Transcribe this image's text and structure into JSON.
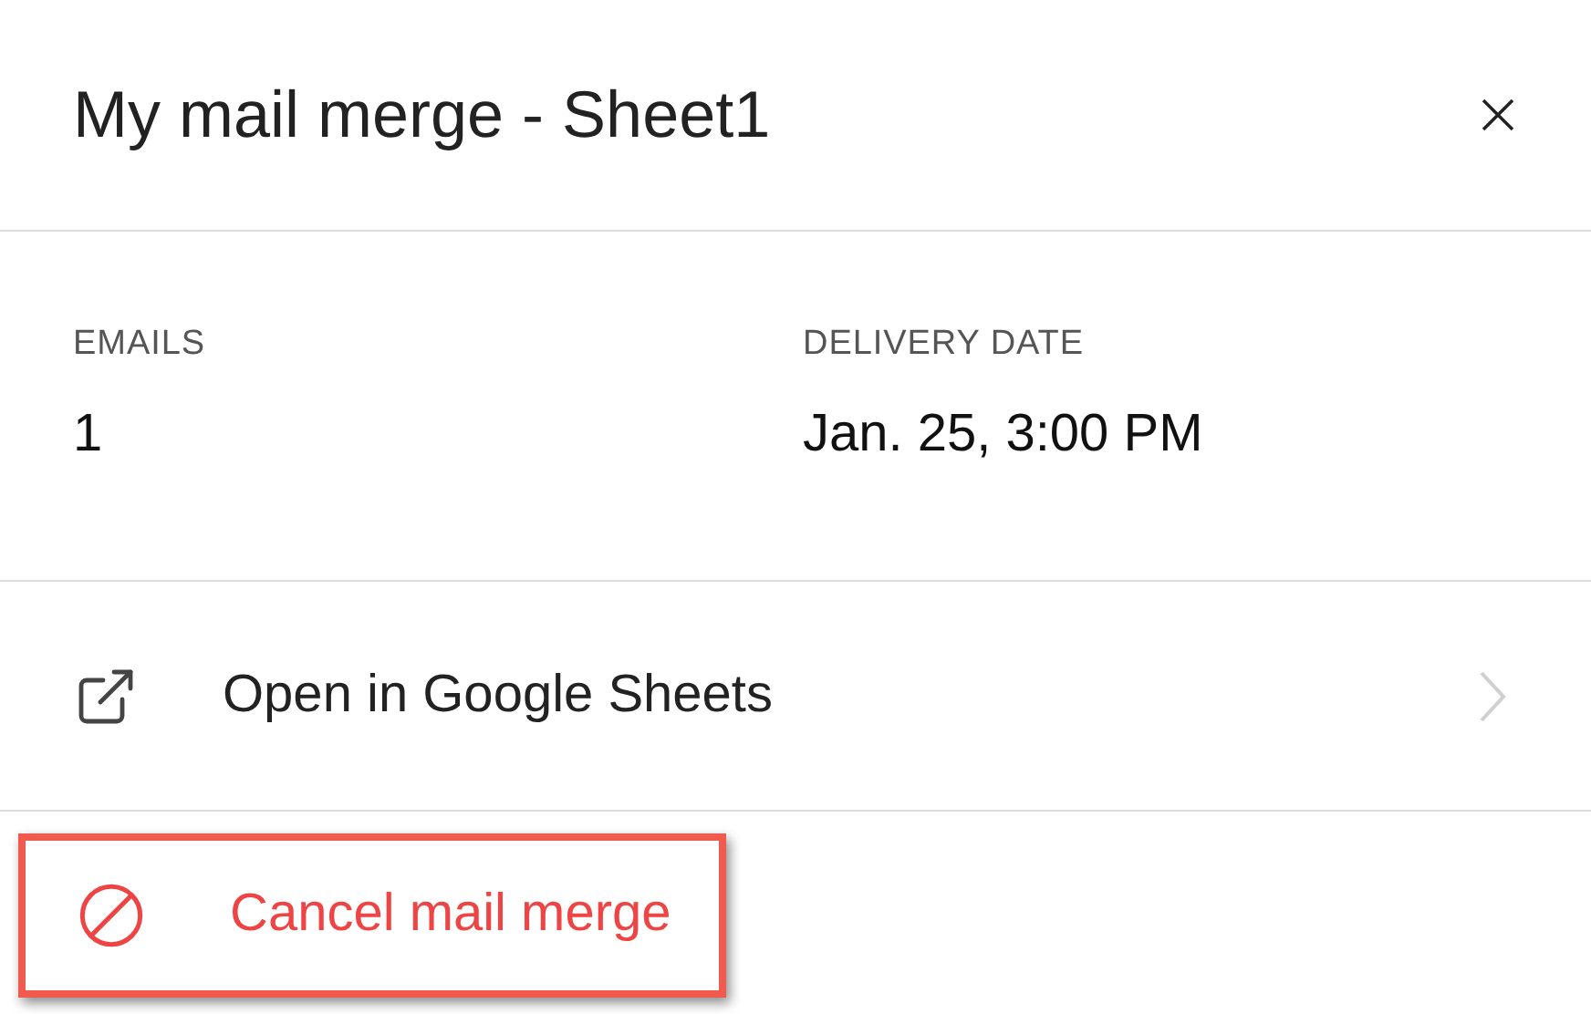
{
  "header": {
    "title": "My mail merge - Sheet1"
  },
  "stats": [
    {
      "label": "EMAILS",
      "value": "1"
    },
    {
      "label": "DELIVERY DATE",
      "value": "Jan. 25, 3:00 PM"
    }
  ],
  "actions": [
    {
      "kind": "link",
      "label": "Open in Google Sheets",
      "highlighted": false
    },
    {
      "kind": "danger",
      "label": "Cancel mail merge",
      "highlighted": true
    }
  ]
}
